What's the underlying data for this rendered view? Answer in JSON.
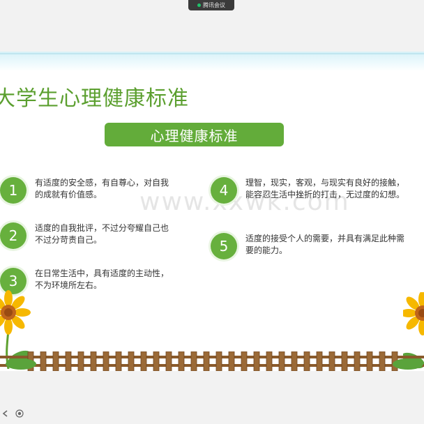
{
  "app": {
    "meeting_label": "腾讯会议"
  },
  "slide": {
    "title": "大学生心理健康标准",
    "section_label": "心理健康标准",
    "watermark": "www.xxwk.com",
    "items": [
      {
        "num": "1",
        "text": "有适度的安全感，有自尊心，对自我的成就有价值感。"
      },
      {
        "num": "2",
        "text": "适度的自我批评，不过分夸耀自己也不过分苛责自己。"
      },
      {
        "num": "3",
        "text": "在日常生活中，具有适度的主动性，不为环境所左右。"
      },
      {
        "num": "4",
        "text": "理智，现实，客观，与现实有良好的接触，能容忍生活中挫折的打击，无过度的幻想。"
      },
      {
        "num": "5",
        "text": "适度的接受个人的需要，并具有满足此种需要的能力。"
      }
    ]
  },
  "colors": {
    "accent_green": "#63ac3a",
    "title_green": "#5b9f2f",
    "fence_brown": "#8a5a2b",
    "sunflower_yellow": "#f6b800"
  },
  "icons": {
    "meeting": "video-icon",
    "left_control": "arrow-left-icon",
    "right_control": "record-icon"
  }
}
